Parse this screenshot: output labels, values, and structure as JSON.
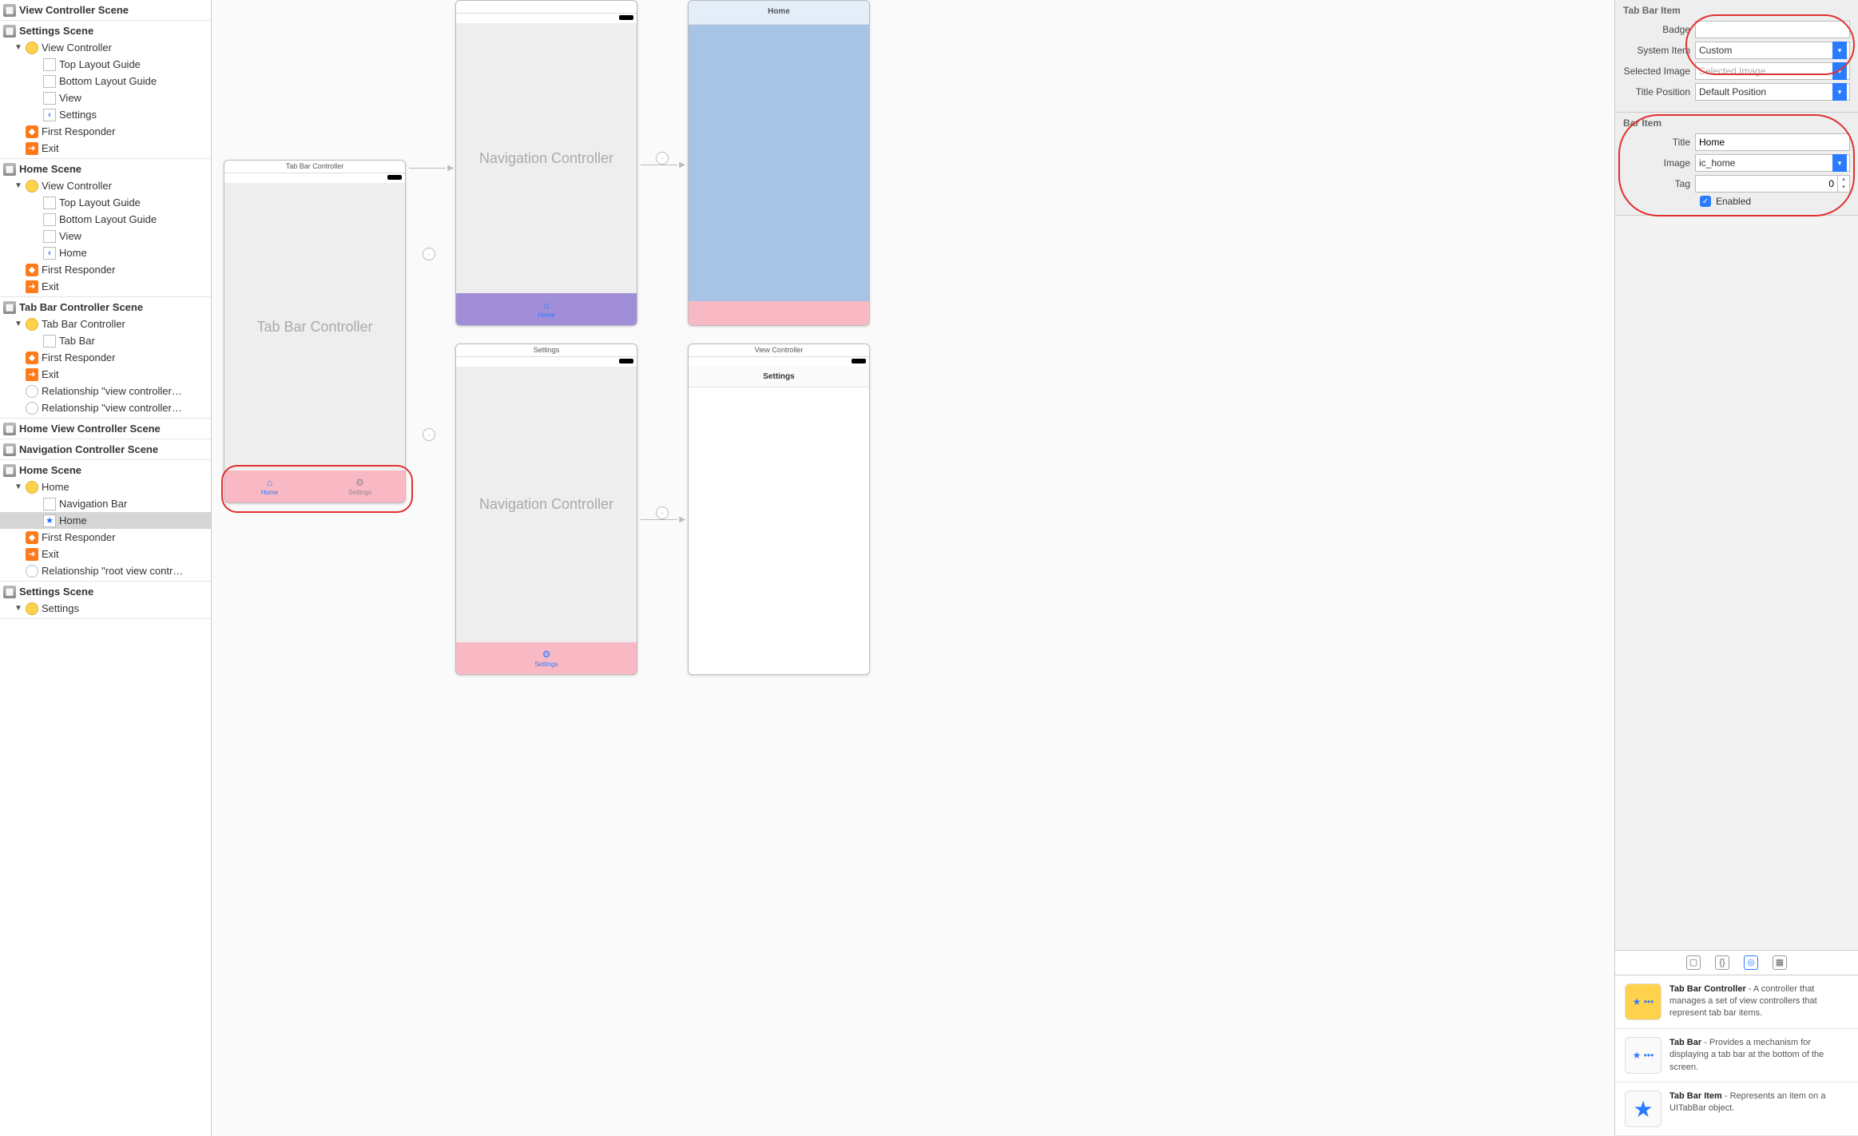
{
  "outline": {
    "groups": [
      {
        "title": "View Controller Scene",
        "icon": "scene"
      },
      {
        "title": "Settings Scene",
        "icon": "scene",
        "rows": [
          {
            "d": 1,
            "i": "vc-yellow",
            "t": "View Controller",
            "disc": "▼"
          },
          {
            "d": 2,
            "i": "rect",
            "t": "Top Layout Guide"
          },
          {
            "d": 2,
            "i": "rect",
            "t": "Bottom Layout Guide"
          },
          {
            "d": 2,
            "i": "rect",
            "t": "View"
          },
          {
            "d": 2,
            "i": "back",
            "t": "Settings"
          },
          {
            "d": 1,
            "i": "cube",
            "t": "First Responder"
          },
          {
            "d": 1,
            "i": "exit",
            "t": "Exit"
          }
        ]
      },
      {
        "title": "Home Scene",
        "icon": "scene",
        "rows": [
          {
            "d": 1,
            "i": "vc-yellow",
            "t": "View Controller",
            "disc": "▼"
          },
          {
            "d": 2,
            "i": "rect",
            "t": "Top Layout Guide"
          },
          {
            "d": 2,
            "i": "rect",
            "t": "Bottom Layout Guide"
          },
          {
            "d": 2,
            "i": "rect",
            "t": "View"
          },
          {
            "d": 2,
            "i": "back",
            "t": "Home"
          },
          {
            "d": 1,
            "i": "cube",
            "t": "First Responder"
          },
          {
            "d": 1,
            "i": "exit",
            "t": "Exit"
          }
        ]
      },
      {
        "title": "Tab Bar Controller Scene",
        "icon": "scene",
        "rows": [
          {
            "d": 1,
            "i": "vc-yellow",
            "t": "Tab Bar Controller",
            "disc": "▼"
          },
          {
            "d": 2,
            "i": "tabbar",
            "t": "Tab Bar"
          },
          {
            "d": 1,
            "i": "cube",
            "t": "First Responder"
          },
          {
            "d": 1,
            "i": "exit",
            "t": "Exit"
          },
          {
            "d": 1,
            "i": "circle",
            "t": "Relationship \"view controller…"
          },
          {
            "d": 1,
            "i": "circle",
            "t": "Relationship \"view controller…"
          }
        ]
      },
      {
        "title": "Home View Controller Scene",
        "icon": "scene"
      },
      {
        "title": "Navigation Controller Scene",
        "icon": "scene"
      },
      {
        "title": "Home Scene",
        "icon": "scene",
        "rows": [
          {
            "d": 1,
            "i": "nav-yellow",
            "t": "Home",
            "disc": "▼"
          },
          {
            "d": 2,
            "i": "rect",
            "t": "Navigation Bar"
          },
          {
            "d": 2,
            "i": "star",
            "t": "Home",
            "selected": true
          },
          {
            "d": 1,
            "i": "cube",
            "t": "First Responder"
          },
          {
            "d": 1,
            "i": "exit",
            "t": "Exit"
          },
          {
            "d": 1,
            "i": "circle",
            "t": "Relationship \"root view contr…"
          }
        ]
      },
      {
        "title": "Settings Scene",
        "icon": "scene",
        "rows": [
          {
            "d": 1,
            "i": "nav-yellow",
            "t": "Settings",
            "disc": "▼",
            "partial": true
          }
        ]
      }
    ]
  },
  "canvas": {
    "tabbar_controller": {
      "title": "Tab Bar Controller",
      "body": "Tab Bar Controller",
      "tabs": [
        {
          "icon": "⌂",
          "label": "Home",
          "color": "#2a7bff"
        },
        {
          "icon": "⚙",
          "label": "Settings",
          "color": "#888"
        }
      ]
    },
    "nav1": {
      "body": "Navigation Controller",
      "tab_icon": "⌂",
      "tab_label": "Home",
      "tab_color": "#2a7bff",
      "bar_color": "#a08fd8"
    },
    "nav2": {
      "title": "Settings",
      "body": "Navigation Controller",
      "tab_icon": "⚙",
      "tab_label": "Settings",
      "tab_color": "#2a7bff",
      "bar_color": "#f9b9c4"
    },
    "home_vc": {
      "nav_title": "Home",
      "body_color": "#a7c3e6",
      "tabbar_color": "#f9b9c4"
    },
    "settings_vc": {
      "title_small": "View Controller",
      "nav_title": "Settings"
    }
  },
  "inspector": {
    "tabBarItem": {
      "heading": "Tab Bar Item",
      "badge_label": "Badge",
      "badge_value": "",
      "system_item_label": "System Item",
      "system_item_value": "Custom",
      "selected_image_label": "Selected Image",
      "selected_image_placeholder": "Selected Image",
      "title_position_label": "Title Position",
      "title_position_value": "Default Position"
    },
    "barItem": {
      "heading": "Bar Item",
      "title_label": "Title",
      "title_value": "Home",
      "image_label": "Image",
      "image_value": "ic_home",
      "tag_label": "Tag",
      "tag_value": "0",
      "enabled_label": "Enabled"
    },
    "library": [
      {
        "title": "Tab Bar Controller",
        "desc": " - A controller that manages a set of view controllers that represent tab bar items.",
        "thumb": "tabcontroller"
      },
      {
        "title": "Tab Bar",
        "desc": " - Provides a mechanism for displaying a tab bar at the bottom of the screen.",
        "thumb": "tabbar"
      },
      {
        "title": "Tab Bar Item",
        "desc": " - Represents an item on a UITabBar object.",
        "thumb": "tabbaritem"
      }
    ]
  }
}
